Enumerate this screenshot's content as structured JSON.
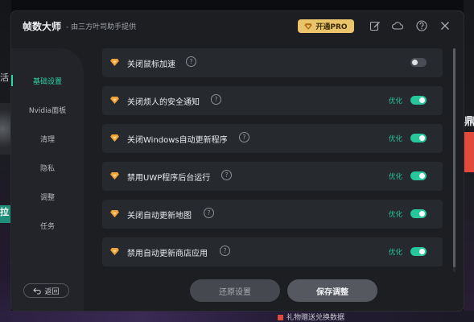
{
  "background": {
    "left_glyph": "活",
    "left_badge": "拉",
    "right_glyph": "鼎",
    "bottom_text": "礼物赠送兑换数据"
  },
  "titlebar": {
    "title": "帧数大师",
    "subtitle": "- 由三方叶司助手提供",
    "pro_label": "开通PRO",
    "icons": [
      "edit-icon",
      "cloud-icon",
      "help-icon",
      "close-icon"
    ]
  },
  "sidebar": {
    "items": [
      {
        "label": "基础设置",
        "active": true
      },
      {
        "label": "Nvidia面板",
        "active": false
      },
      {
        "label": "清理",
        "active": false
      },
      {
        "label": "隐私",
        "active": false
      },
      {
        "label": "调整",
        "active": false
      },
      {
        "label": "任务",
        "active": false
      }
    ],
    "back_label": "返回"
  },
  "settings": {
    "rows": [
      {
        "label": "关闭鼠标加速",
        "optimized_label": "",
        "enabled": false
      },
      {
        "label": "关闭烦人的安全通知",
        "optimized_label": "优化",
        "enabled": true
      },
      {
        "label": "关闭Windows自动更新程序",
        "optimized_label": "优化",
        "enabled": true
      },
      {
        "label": "禁用UWP程序后台运行",
        "optimized_label": "优化",
        "enabled": true
      },
      {
        "label": "关闭自动更新地图",
        "optimized_label": "优化",
        "enabled": true
      },
      {
        "label": "禁用自动更新商店应用",
        "optimized_label": "优化",
        "enabled": true
      }
    ],
    "help_glyph": "?"
  },
  "footer": {
    "reset_label": "还原设置",
    "save_label": "保存调整"
  },
  "colors": {
    "accent": "#26c79a",
    "pro_gold": "#e9c46a",
    "gem_orange": "#f0a23a"
  }
}
